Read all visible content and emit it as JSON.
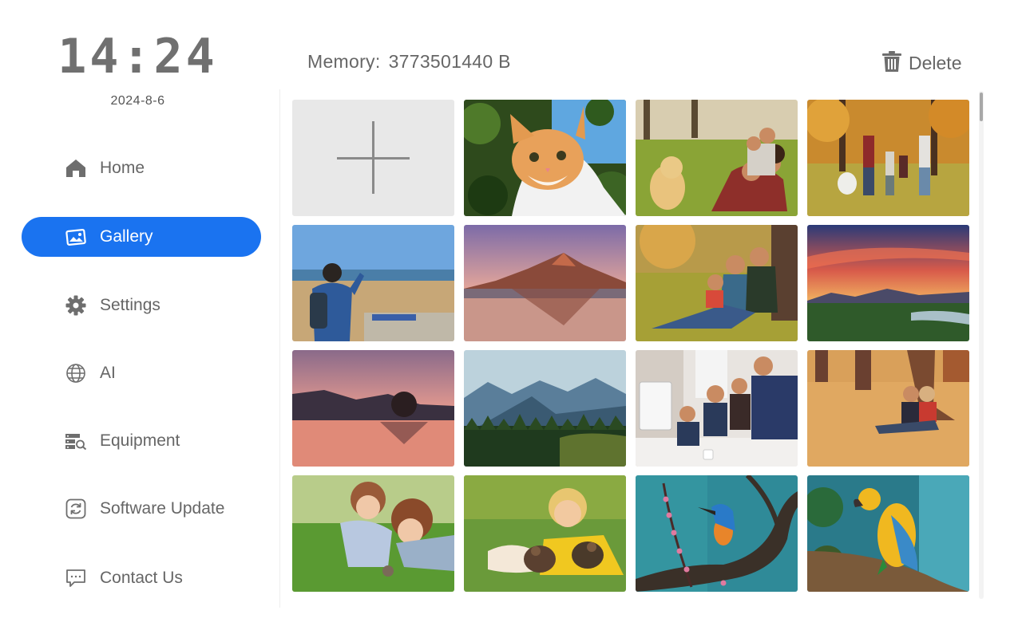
{
  "clock": {
    "time": "14:24",
    "date": "2024-8-6"
  },
  "nav": {
    "items": [
      {
        "label": "Home",
        "icon": "home-icon"
      },
      {
        "label": "Gallery",
        "icon": "gallery-icon",
        "active": true
      },
      {
        "label": "Settings",
        "icon": "gear-icon"
      },
      {
        "label": "AI",
        "icon": "globe-icon"
      },
      {
        "label": "Equipment",
        "icon": "equipment-icon"
      },
      {
        "label": "Software Update",
        "icon": "refresh-icon"
      },
      {
        "label": "Contact Us",
        "icon": "chat-icon"
      }
    ]
  },
  "header": {
    "memory_label": "Memory:",
    "memory_value": "3773501440 B",
    "delete_label": "Delete",
    "delete_icon": "trash-icon"
  },
  "gallery": {
    "add_icon": "plus-icon",
    "photos": [
      "orange kitten in leaves",
      "family with golden retriever in park",
      "family running with dog in autumn park",
      "man with binoculars at seashore",
      "mountain reflected in lake at sunset",
      "family sitting under tree",
      "sunset over mountains and forest",
      "pink sunset over lake with tree island",
      "blue mountains and pine forest",
      "team working around computer",
      "couple sitting in autumn leaves",
      "two girls lying in grass",
      "smiling girl with kittens in grass",
      "kingfisher on blossoming branch",
      "yellow parrot on branch"
    ]
  },
  "colors": {
    "accent": "#1a73f0",
    "text": "#666666",
    "add_tile": "#e8e8e8"
  }
}
